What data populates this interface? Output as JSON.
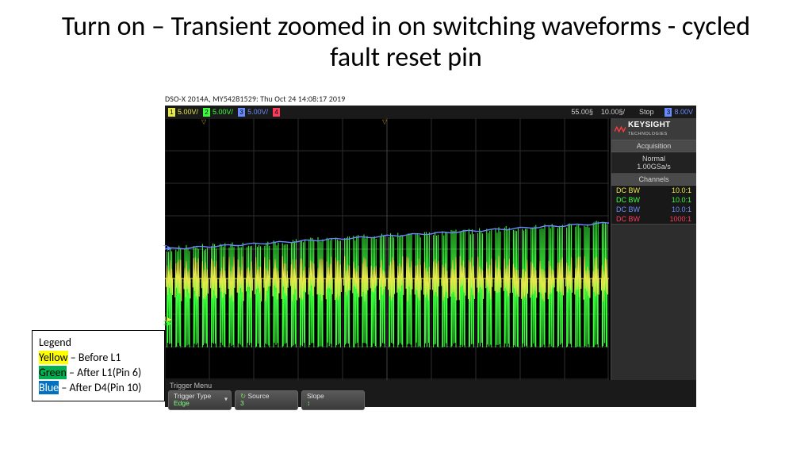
{
  "title": "Turn on – Transient zoomed in on switching waveforms - cycled fault reset pin",
  "scope_meta": "DSO-X 2014A, MY54281529: Thu Oct 24 14:08:17 2019",
  "topbar": {
    "ch1_div": "5.00V/",
    "ch2_div": "5.00V/",
    "ch3_div": "5.00V/",
    "timebase1": "55.00§",
    "timebase2": "10.00§/",
    "status": "Stop",
    "trig_volts": "8.00V"
  },
  "brand": {
    "name": "KEYSIGHT",
    "sub": "TECHNOLOGIES"
  },
  "acq": {
    "header": "Acquisition",
    "mode": "Normal",
    "rate": "1.00GSa/s"
  },
  "channels": {
    "header": "Channels",
    "rows": [
      {
        "mode": "DC BW",
        "ratio": "10.0:1",
        "cls": "c1t"
      },
      {
        "mode": "DC BW",
        "ratio": "10.0:1",
        "cls": "c2t"
      },
      {
        "mode": "DC BW",
        "ratio": "10.0:1",
        "cls": "c3t"
      },
      {
        "mode": "DC BW",
        "ratio": "1000:1",
        "cls": "c4t"
      }
    ]
  },
  "trigger": {
    "menu": "Trigger Menu",
    "type_label": "Trigger Type",
    "type_val": "Edge",
    "source_label": "Source",
    "source_val": "3",
    "slope_label": "Slope",
    "slope_icon": "↕"
  },
  "legend": {
    "title": "Legend",
    "yellow_tag": "Yellow",
    "yellow_txt": " – Before L1",
    "green_tag": "Green",
    "green_txt": " – After L1(Pin 6)",
    "blue_tag": "Blue",
    "blue_txt": " – After D4(Pin 10)"
  },
  "chart_data": {
    "type": "line",
    "time_window_us": 100,
    "timebase_us_per_div": 10,
    "vdiv_per_channel_V": 5.0,
    "grid_divs_x": 10,
    "grid_divs_y": 8,
    "series": [
      {
        "name": "Ch1 Yellow – Before L1",
        "color": "#e8e84a",
        "description": "Dense switching bursts centered near y≈-1 div with spikes ±~1.5 div at ~50 evenly spaced bursts across window",
        "baseline_div": -0.9,
        "burst_count": 50,
        "burst_amp_div": 1.4
      },
      {
        "name": "Ch2 Green – After L1(Pin 6)",
        "color": "#3cff3c",
        "description": "Tall narrow switching spikes from bottom up to near Ch3 line, ~50 spikes across window, gently rising envelope",
        "baseline_div": -3.0,
        "burst_count": 50,
        "burst_amp_div": 3.2,
        "envelope_rise_div": 0.6
      },
      {
        "name": "Ch3 Blue – After D4(Pin 10)",
        "color": "#6a8bff",
        "description": "Monotonic ramp from about 0 div at left to about +0.8 div at right with small ripple",
        "y_start_div": 0.0,
        "y_end_div": 0.8
      }
    ],
    "trigger": {
      "source": 3,
      "level_V": 8.0,
      "slope": "either"
    }
  }
}
